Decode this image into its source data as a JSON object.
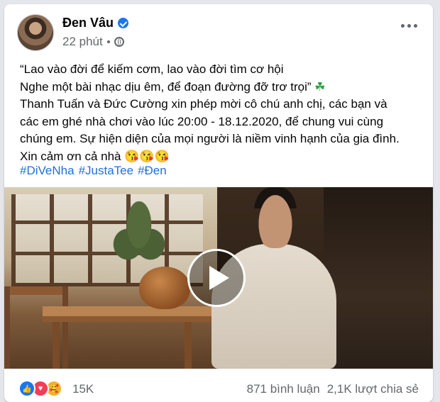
{
  "post": {
    "author": "Đen Vâu",
    "time": "22 phút",
    "privacy_icon": "globe-icon",
    "text_lines": [
      "“Lao vào đời để kiếm cơm, lao vào đời tìm cơ hội",
      "Nghe một bài nhạc dịu êm, để đoạn đường đỡ trơ trọi” ",
      "Thanh Tuấn và Đức Cường xin phép mời cô chú anh chị, các bạn và",
      "các em ghé nhà chơi vào lúc 20:00 - 18.12.2020, để chung vui cùng",
      "chúng em. Sự hiện diện của mọi người là niềm vinh hạnh của gia đình.",
      "Xin cảm ơn cả nhà "
    ],
    "clover_emoji": "☘",
    "kiss_emojis": "😘😘😘",
    "hashtags": [
      "#DiVeNha",
      "#JustaTee",
      "#Đen"
    ]
  },
  "reactions": {
    "icons": [
      "like-icon",
      "love-icon",
      "care-icon"
    ],
    "like_glyph": "👍",
    "love_glyph": "♥",
    "care_glyph": "🥰",
    "count": "15K"
  },
  "stats": {
    "comments": "871 bình luận",
    "shares": "2,1K lượt chia sẻ"
  },
  "colors": {
    "link": "#216fdb",
    "verified": "#1877f2",
    "secondary_text": "#65676b"
  }
}
